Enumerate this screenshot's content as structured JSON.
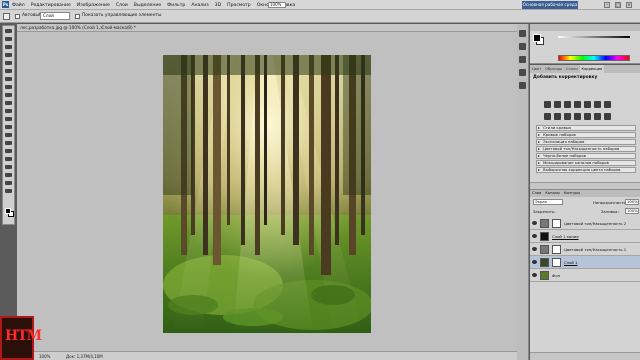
{
  "menubar": {
    "logo": "Ps",
    "items": [
      "Файл",
      "Редактирование",
      "Изображение",
      "Слои",
      "Выделение",
      "Фильтр",
      "Анализ",
      "3D",
      "Просмотр",
      "Окно",
      "Справка"
    ],
    "zoom": "100%",
    "workspace": "Основная рабочая среда",
    "win_buttons": [
      "–",
      "□",
      "×"
    ]
  },
  "optionsbar": {
    "autoselect_label": "Автовыбор:",
    "autoselect_value": "Слой",
    "transform_label": "Показать управляющие элементы"
  },
  "document": {
    "tab_title": "лес,разработка.jpg @ 100% (Слой 1, Слой-маска/8) *",
    "close": "×"
  },
  "statusbar": {
    "zoom": "100%",
    "info": "Док: 1,37M/4,10M"
  },
  "logo": {
    "text": "НТМ"
  },
  "adjustments": {
    "tabs": [
      "Цвет",
      "Образцы",
      "Стили",
      "Коррекция"
    ],
    "heading": "Добавить корректировку",
    "presets": [
      "Стили кривых",
      "Кривые наборов",
      "Экспозиция наборов",
      "Цветовой тон/Насыщенность наборов",
      "Черно-белое наборов",
      "Микширование каналов наборов",
      "Выборочная коррекция цвета наборов"
    ]
  },
  "layers": {
    "tabs": [
      "Слои",
      "Каналы",
      "Контуры"
    ],
    "blend_mode": "Экран",
    "opacity_label": "Непрозрачность:",
    "opacity_value": "100%",
    "lock_label": "Закрепить:",
    "fill_label": "Заливка:",
    "fill_value": "100%",
    "items": [
      {
        "name": "Цветовой тон/Насыщенность 2"
      },
      {
        "name": "Слой 1 копия"
      },
      {
        "name": "Цветовой тон/Насыщенность 1"
      },
      {
        "name": "Слой 1"
      },
      {
        "name": "Фон"
      }
    ]
  },
  "colors": {
    "menubar_bg": "#d7d7d7",
    "workspace_btn": "#3b5f93",
    "canvas_bg": "#c0c0c0",
    "logo_red": "#ff2a2a"
  }
}
